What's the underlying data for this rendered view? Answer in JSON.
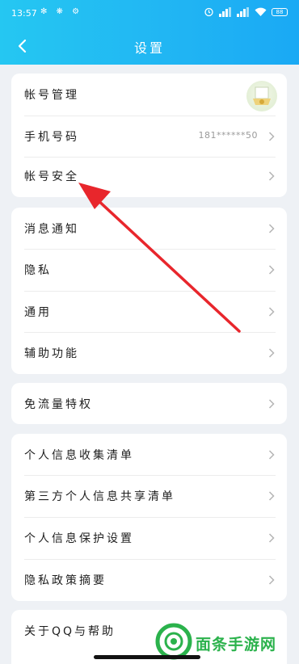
{
  "status_bar": {
    "time": "13:57",
    "left_icons": "✻ ❋ ⚙",
    "battery": "88"
  },
  "header": {
    "back_icon": "chevron-left-icon",
    "title": "设置"
  },
  "sections": [
    {
      "items": [
        {
          "label": "帐号管理",
          "value": "",
          "has_avatar": true
        },
        {
          "label": "手机号码",
          "value": "181******50"
        },
        {
          "label": "帐号安全",
          "value": ""
        }
      ]
    },
    {
      "items": [
        {
          "label": "消息通知"
        },
        {
          "label": "隐私"
        },
        {
          "label": "通用"
        },
        {
          "label": "辅助功能"
        }
      ]
    },
    {
      "items": [
        {
          "label": "免流量特权"
        }
      ]
    },
    {
      "items": [
        {
          "label": "个人信息收集清单"
        },
        {
          "label": "第三方个人信息共享清单"
        },
        {
          "label": "个人信息保护设置"
        },
        {
          "label": "隐私政策摘要"
        }
      ]
    },
    {
      "items": [
        {
          "label": "关于QQ与帮助"
        }
      ]
    }
  ],
  "watermark": {
    "text": "面条手游网"
  },
  "colors": {
    "header_gradient_start": "#25c7f2",
    "header_gradient_end": "#1aa9f4",
    "annotation_arrow": "#e8262c",
    "watermark_green": "#2bb24c",
    "background": "#eef1f5"
  }
}
